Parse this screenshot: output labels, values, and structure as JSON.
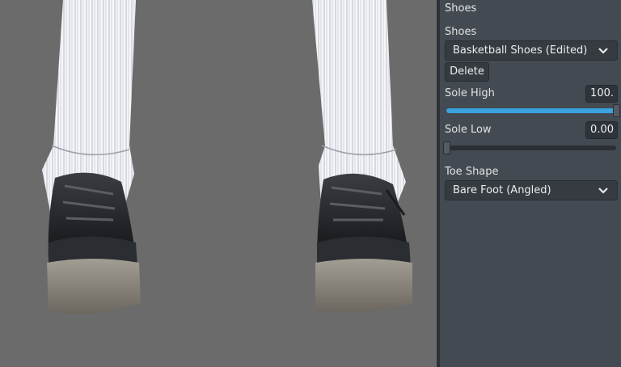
{
  "viewport": {
    "background": "#6b6b6b",
    "subject": "shoes-preview"
  },
  "panel": {
    "title": "Shoes",
    "shoes_label": "Shoes",
    "shoes_selected": "Basketball Shoes (Edited)",
    "delete_label": "Delete",
    "sole_high_label": "Sole High",
    "sole_high_value": "100.",
    "sole_high_level": 1.0,
    "sole_low_label": "Sole Low",
    "sole_low_value": "0.00",
    "sole_low_level": 0.0,
    "toe_shape_label": "Toe Shape",
    "toe_shape_selected": "Bare Foot (Angled)",
    "accent": "#3ba3de",
    "dropdown_icon": "chevron-down-icon"
  }
}
